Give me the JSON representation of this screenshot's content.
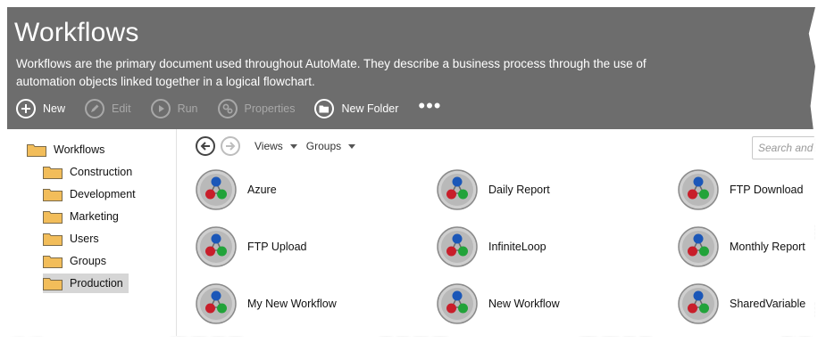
{
  "header": {
    "title": "Workflows",
    "description": "Workflows are the primary document used throughout AutoMate. They describe a business process through the use of automation objects linked together in a logical flowchart."
  },
  "toolbar": {
    "new_label": "New",
    "edit_label": "Edit",
    "run_label": "Run",
    "properties_label": "Properties",
    "new_folder_label": "New Folder",
    "more_label": "•••"
  },
  "tree": {
    "root": "Workflows",
    "folders": [
      "Construction",
      "Development",
      "Marketing",
      "Users",
      "Groups",
      "Production"
    ],
    "selected": "Production"
  },
  "content": {
    "views_label": "Views",
    "groups_label": "Groups",
    "search_placeholder": "Search and filter",
    "workflows": [
      "Azure",
      "Daily Report",
      "FTP Download",
      "FTP Upload",
      "InfiniteLoop",
      "Monthly Report",
      "My New Workflow",
      "New Workflow",
      "SharedVariable"
    ]
  },
  "colors": {
    "header_bg": "#6d6d6d",
    "folder": "#f2bd5a",
    "node_blue": "#1b57b8",
    "node_red": "#c81e2a",
    "node_green": "#22a33a"
  }
}
